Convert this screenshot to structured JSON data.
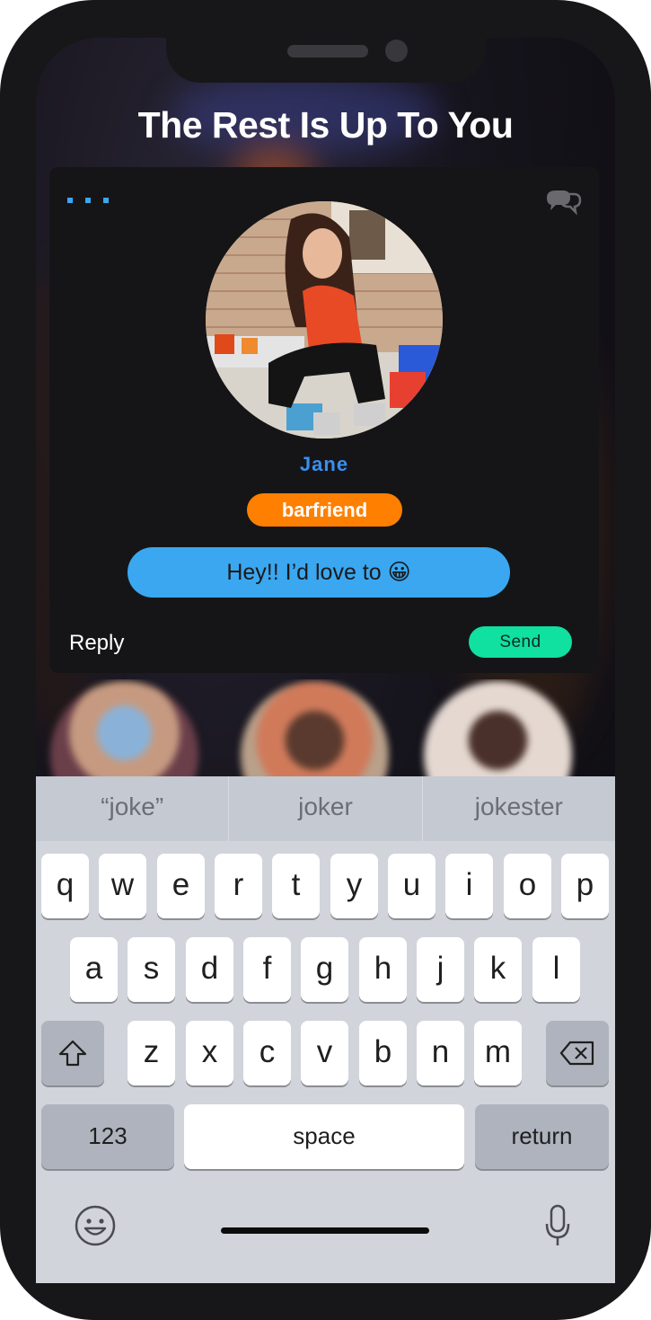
{
  "headline": "The Rest Is Up To You",
  "card": {
    "name": "Jane",
    "badge": "barfriend",
    "message": "Hey!! I’d love to 😀",
    "reply_label": "Reply",
    "send_label": "Send"
  },
  "keyboard": {
    "suggestions": [
      "“joke”",
      "joker",
      "jokester"
    ],
    "row1": [
      "q",
      "w",
      "e",
      "r",
      "t",
      "y",
      "u",
      "i",
      "o",
      "p"
    ],
    "row2": [
      "a",
      "s",
      "d",
      "f",
      "g",
      "h",
      "j",
      "k",
      "l"
    ],
    "row3": [
      "z",
      "x",
      "c",
      "v",
      "b",
      "n",
      "m"
    ],
    "numbers_label": "123",
    "space_label": "space",
    "return_label": "return"
  },
  "colors": {
    "accent_blue": "#3aa7f0",
    "name_blue": "#3a8ff0",
    "badge_orange": "#ff7f00",
    "send_green": "#10e0a0"
  }
}
